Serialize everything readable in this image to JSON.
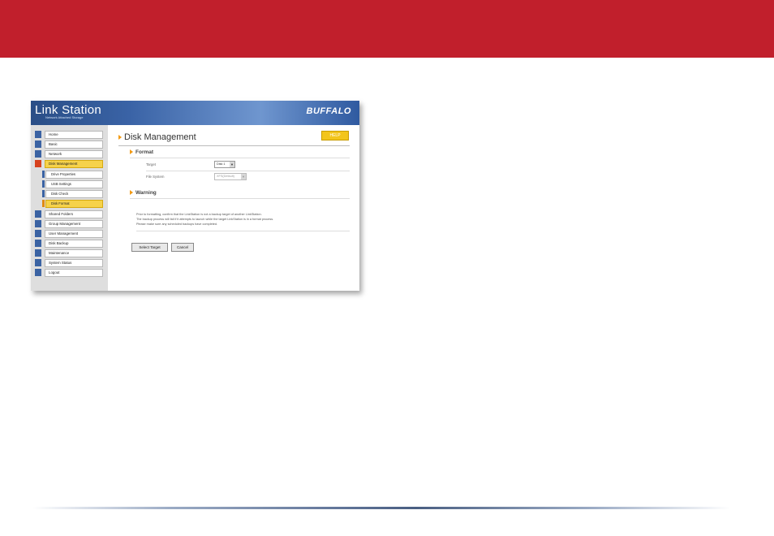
{
  "app": {
    "brand": "Link Station",
    "brand_sub": "Network Attached Storage",
    "vendor": "BUFFALO"
  },
  "sidebar": {
    "items": [
      {
        "label": "Home",
        "icon": "home-icon",
        "active": false
      },
      {
        "label": "Basic",
        "icon": "basic-icon",
        "active": false
      },
      {
        "label": "Network",
        "icon": "network-icon",
        "active": false
      },
      {
        "label": "Disk Management",
        "icon": "disk-icon",
        "active": true
      },
      {
        "label": "Shared Folders",
        "icon": "folder-icon",
        "active": false
      },
      {
        "label": "Group Management",
        "icon": "group-icon",
        "active": false
      },
      {
        "label": "User Management",
        "icon": "user-icon",
        "active": false
      },
      {
        "label": "Disk Backup",
        "icon": "backup-icon",
        "active": false
      },
      {
        "label": "Maintenance",
        "icon": "maintenance-icon",
        "active": false
      },
      {
        "label": "System Status",
        "icon": "status-icon",
        "active": false
      },
      {
        "label": "Logout",
        "icon": "logout-icon",
        "active": false
      }
    ],
    "sub_items": [
      {
        "label": "Drive Properties",
        "active": false
      },
      {
        "label": "USB Settings",
        "active": false
      },
      {
        "label": "Disk Check",
        "active": false
      },
      {
        "label": "Disk Format",
        "active": true
      }
    ]
  },
  "main": {
    "title": "Disk Management",
    "help_label": "HELP",
    "format": {
      "heading": "Format",
      "target_label": "Target",
      "target_value": "Disk 1",
      "fs_label": "File System",
      "fs_value": "XFS(Default)"
    },
    "warning": {
      "heading": "Warning",
      "lines": [
        "Prior to formatting, confirm that the LinkStation is not a backup target of another LinkStation.",
        "The backup process will fail if it attempts to launch while the target LinkStation is in a format process.",
        "Please make sure any scheduled backups have completed."
      ]
    },
    "buttons": {
      "select": "Select Target",
      "cancel": "Cancel"
    }
  },
  "colors": {
    "top_bar": "#c11f2c",
    "accent_yellow": "#f6d24a",
    "header_blue": "#3a63a6",
    "bullet_orange": "#f29a13"
  }
}
